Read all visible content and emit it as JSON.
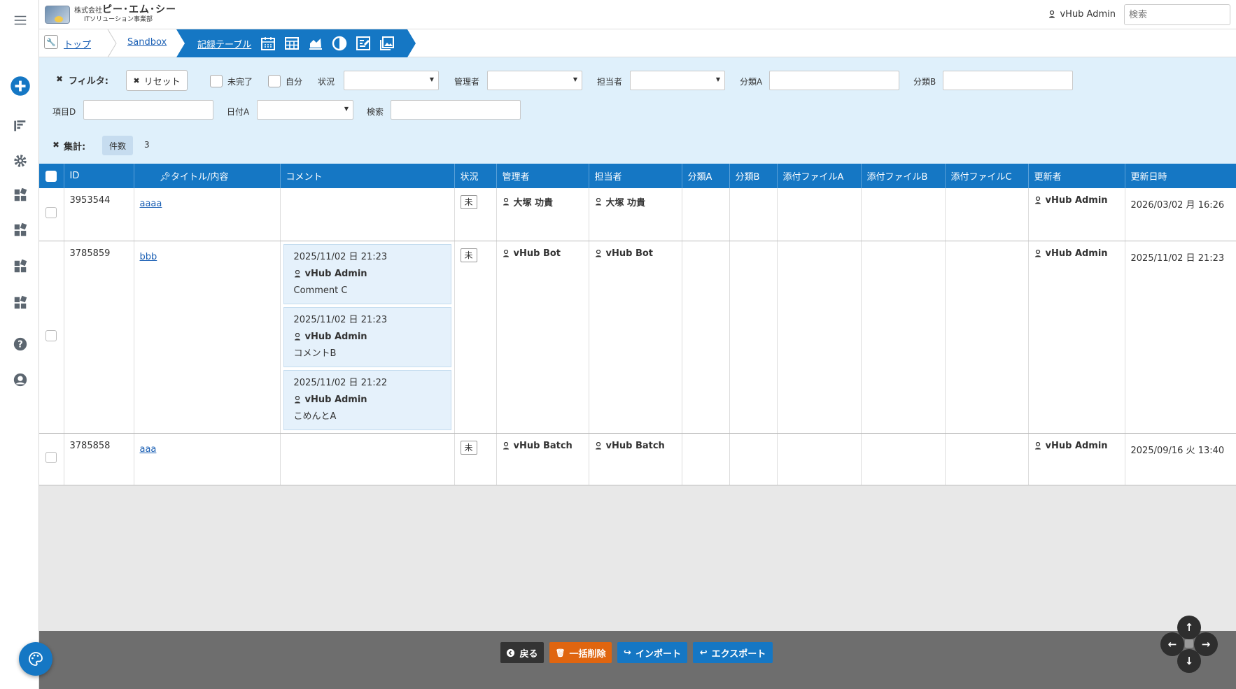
{
  "header": {
    "logo_line1_small": "株式会社",
    "logo_line1_big": "ピー･エム･シー",
    "logo_line2": "ITソリューション事業部",
    "user_name": "vHub Admin",
    "search_placeholder": "検索"
  },
  "breadcrumb": {
    "top": "トップ",
    "sandbox": "Sandbox",
    "current": "記録テーブル",
    "views": [
      "calendar-icon",
      "grid-icon",
      "chart-icon",
      "pie-icon",
      "kamban-icon",
      "image-icon"
    ]
  },
  "filter": {
    "title": "フィルタ:",
    "reset": "リセット",
    "incomplete": "未完了",
    "self": "自分",
    "status": "状況",
    "manager": "管理者",
    "assignee": "担当者",
    "classA": "分類A",
    "classB": "分類B",
    "itemD": "項目D",
    "dateA": "日付A",
    "search": "検索"
  },
  "aggregation": {
    "title": "集計:",
    "count_label": "件数",
    "count_value": "3"
  },
  "table": {
    "columns": [
      "ID",
      "タイトル/内容",
      "コメント",
      "状況",
      "管理者",
      "担当者",
      "分類A",
      "分類B",
      "添付ファイルA",
      "添付ファイルB",
      "添付ファイルC",
      "更新者",
      "更新日時"
    ],
    "rows": [
      {
        "id": "3953544",
        "title": "aaaa",
        "comments": [],
        "status": "未",
        "manager": "大塚 功貴",
        "assignee": "大塚 功貴",
        "updater": "vHub Admin",
        "updated": "2026/03/02 月 16:26"
      },
      {
        "id": "3785859",
        "title": "bbb",
        "comments": [
          {
            "time": "2025/11/02 日 21:23",
            "user": "vHub Admin",
            "text": "Comment C"
          },
          {
            "time": "2025/11/02 日 21:23",
            "user": "vHub Admin",
            "text": "コメントB"
          },
          {
            "time": "2025/11/02 日 21:22",
            "user": "vHub Admin",
            "text": "こめんとA"
          }
        ],
        "status": "未",
        "manager": "vHub Bot",
        "assignee": "vHub Bot",
        "updater": "vHub Admin",
        "updated": "2025/11/02 日 21:23"
      },
      {
        "id": "3785858",
        "title": "aaa",
        "comments": [],
        "status": "未",
        "manager": "vHub Batch",
        "assignee": "vHub Batch",
        "updater": "vHub Admin",
        "updated": "2025/09/16 火 13:40"
      }
    ]
  },
  "footer": {
    "back": "戻る",
    "bulk_delete": "一括削除",
    "import": "インポート",
    "export": "エクスポート"
  },
  "colors": {
    "primary": "#1577c4",
    "filter_bg": "#dff0fb",
    "delete": "#e0650f",
    "footer_bg": "#6e6e6e"
  }
}
